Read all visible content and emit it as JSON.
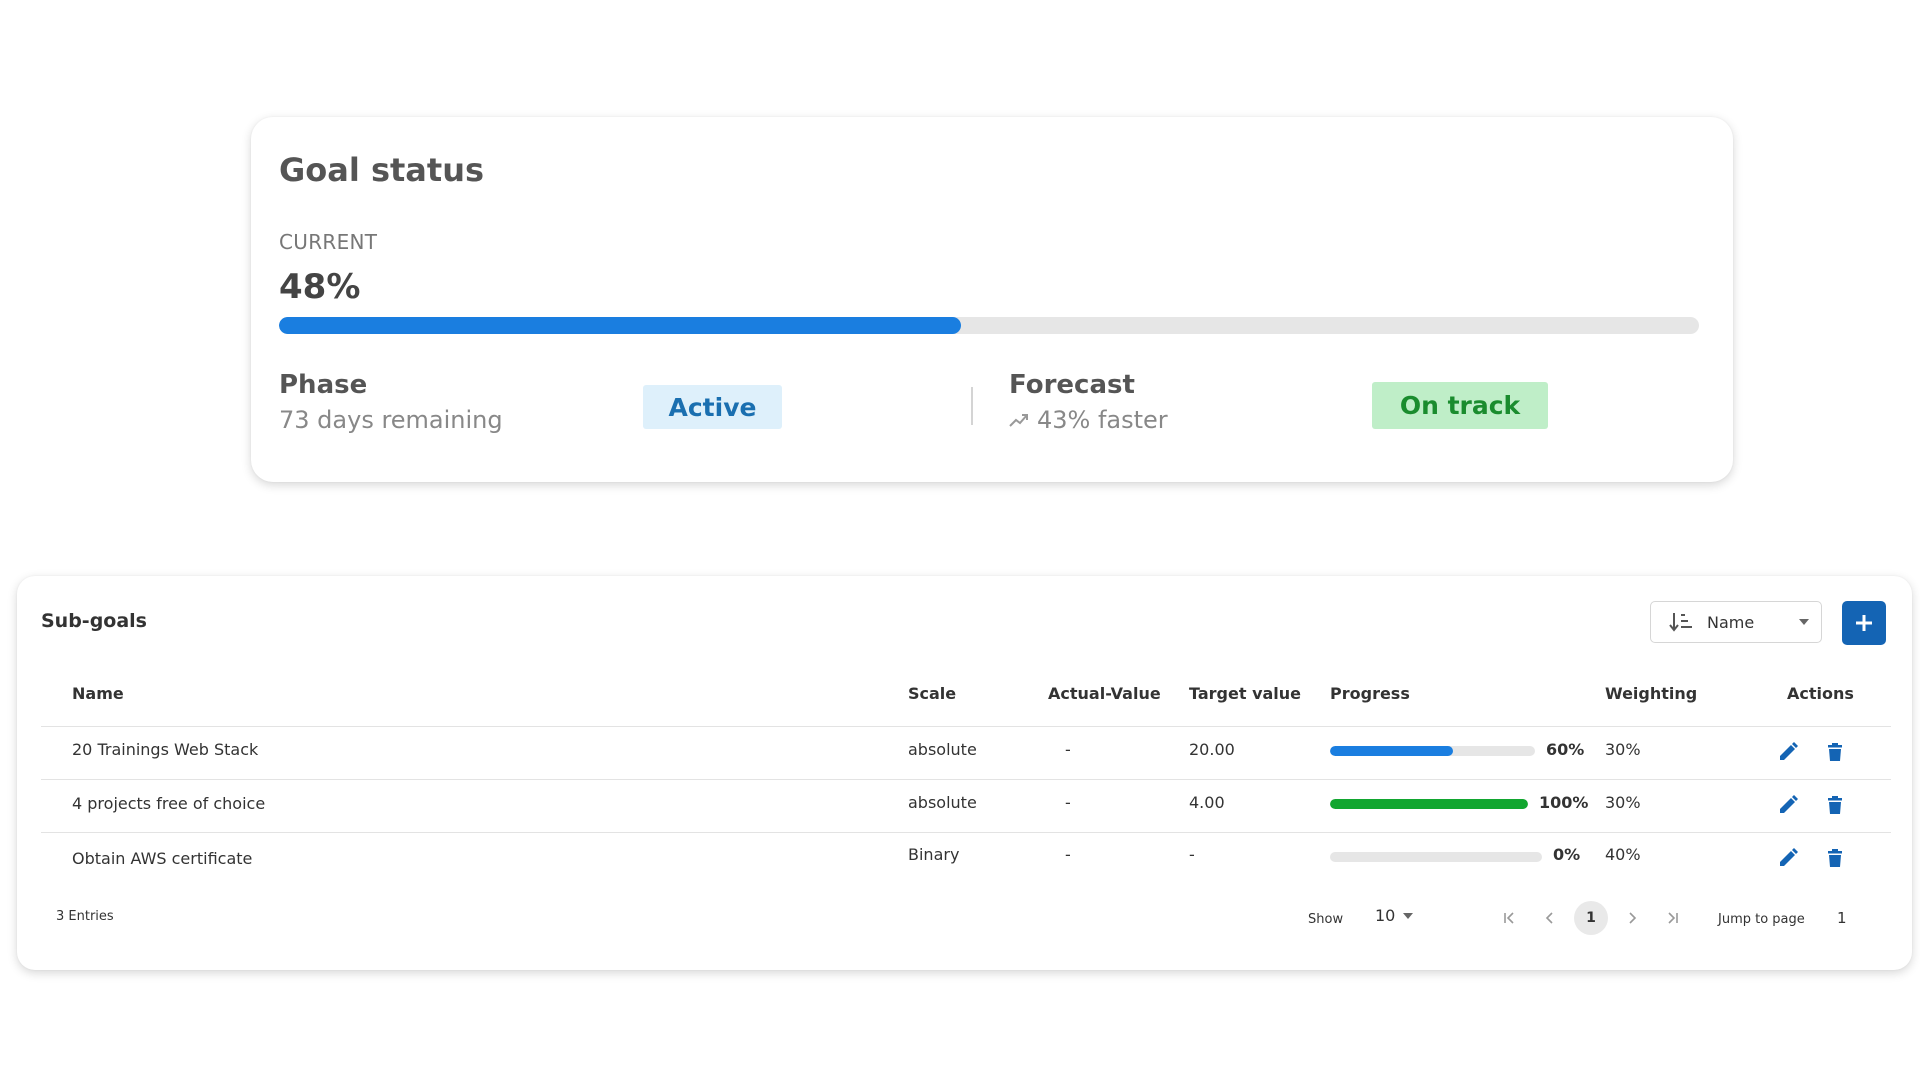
{
  "goal_status": {
    "title": "Goal status",
    "current_label": "CURRENT",
    "current_value": "48%",
    "progress_fraction": 0.48,
    "progress_color": "#1a7ee0",
    "phase": {
      "title": "Phase",
      "subtitle": "73 days remaining",
      "badge": "Active"
    },
    "forecast": {
      "title": "Forecast",
      "subtitle": "43% faster",
      "trend_icon": "trending-up-icon",
      "badge": "On track"
    }
  },
  "subgoals": {
    "title": "Sub-goals",
    "sort": {
      "icon": "sort-ascending-icon",
      "selected": "Name"
    },
    "add_icon": "plus-icon",
    "columns": {
      "name": "Name",
      "scale": "Scale",
      "actual": "Actual-Value",
      "target": "Target value",
      "progress": "Progress",
      "weighting": "Weighting",
      "actions": "Actions"
    },
    "rows": [
      {
        "name": "20 Trainings Web Stack",
        "scale": "absolute",
        "actual": "-",
        "target": "20.00",
        "progress": 0.6,
        "progress_label": "60%",
        "progress_color": "#1a7ee0",
        "weighting": "30%"
      },
      {
        "name": "4 projects free of choice",
        "scale": "absolute",
        "actual": "-",
        "target": "4.00",
        "progress": 1.0,
        "progress_label": "100%",
        "progress_color": "#12a630",
        "weighting": "30%"
      },
      {
        "name": "Obtain AWS certificate",
        "scale": "Binary",
        "actual": "-",
        "target": "-",
        "progress": 0.0,
        "progress_label": "0%",
        "progress_color": "#1a7ee0",
        "weighting": "40%"
      }
    ],
    "action_icons": {
      "edit": "pencil-icon",
      "delete": "trash-icon"
    },
    "accent_color": "#1464b4",
    "footer": {
      "entries": "3 Entries",
      "show_label": "Show",
      "page_size": "10",
      "current_page": "1",
      "jump_label": "Jump to page",
      "jump_value": "1"
    }
  }
}
